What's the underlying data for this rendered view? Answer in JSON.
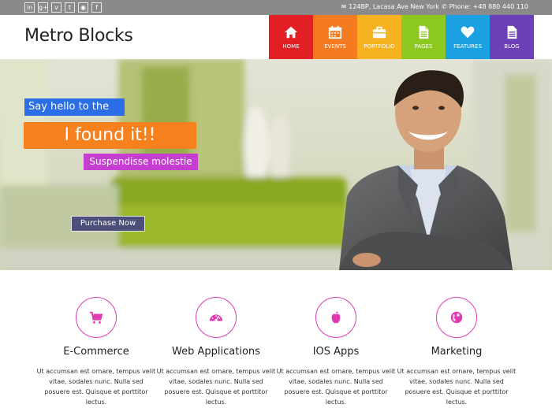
{
  "topbar": {
    "social_icons": [
      {
        "name": "linkedin-icon",
        "glyph": "in"
      },
      {
        "name": "google-plus-icon",
        "glyph": "g+"
      },
      {
        "name": "vimeo-icon",
        "glyph": "v"
      },
      {
        "name": "twitter-icon",
        "glyph": "t"
      },
      {
        "name": "github-icon",
        "glyph": "◉"
      },
      {
        "name": "facebook-icon",
        "glyph": "f"
      }
    ],
    "address": "124BP, Lacasa Ave New York",
    "phone": "Phone: +48 880 440 110"
  },
  "header": {
    "logo": "Metro Blocks",
    "nav": [
      {
        "label": "HOME",
        "color": "#e31f26",
        "icon": "home-icon"
      },
      {
        "label": "EVENTS",
        "color": "#f47b20",
        "icon": "calendar-icon"
      },
      {
        "label": "PORTFOLIO",
        "color": "#f7b31f",
        "icon": "briefcase-icon"
      },
      {
        "label": "PAGES",
        "color": "#8cc81f",
        "icon": "document-icon"
      },
      {
        "label": "FEATURES",
        "color": "#1ba1e2",
        "icon": "heart-icon"
      },
      {
        "label": "BLOG",
        "color": "#6b3fb6",
        "icon": "file-text-icon"
      }
    ]
  },
  "hero": {
    "caption_small": "Say hello to the",
    "caption_big": "I found it!!",
    "caption_sub": "Suspendisse molestie",
    "button": "Purchase Now",
    "colors": {
      "blue": "#2b6ee8",
      "orange": "#f7811e",
      "magenta": "#c63ed1"
    }
  },
  "features": [
    {
      "title": "E-Commerce",
      "icon": "shopping-cart-icon",
      "desc": "Ut accumsan est ornare, tempus velit vitae, sodales nunc. Nulla sed posuere est. Quisque et porttitor lectus."
    },
    {
      "title": "Web Applications",
      "icon": "dashboard-icon",
      "desc": "Ut accumsan est ornare, tempus velit vitae, sodales nunc. Nulla sed posuere est. Quisque et porttitor lectus."
    },
    {
      "title": "IOS Apps",
      "icon": "apple-icon",
      "desc": "Ut accumsan est ornare, tempus velit vitae, sodales nunc. Nulla sed posuere est. Quisque et porttitor lectus."
    },
    {
      "title": "Marketing",
      "icon": "globe-icon",
      "desc": "Ut accumsan est ornare, tempus velit vitae, sodales nunc. Nulla sed posuere est. Quisque et porttitor lectus."
    }
  ],
  "accent_color": "#e03ab2"
}
